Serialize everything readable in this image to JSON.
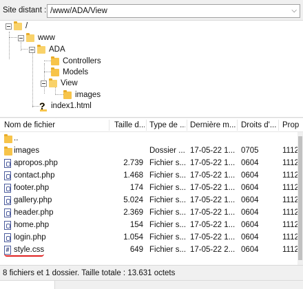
{
  "pathbar": {
    "label": "Site distant :",
    "value": "/www/ADA/View"
  },
  "tree": {
    "root": "/",
    "www": "www",
    "ada": "ADA",
    "controllers": "Controllers",
    "models": "Models",
    "view": "View",
    "images": "images",
    "index": "index1.html"
  },
  "columns": {
    "name": "Nom de fichier",
    "size": "Taille d...",
    "type": "Type de ...",
    "modified": "Dernière m...",
    "rights": "Droits d'...",
    "owner": "Propr"
  },
  "files": [
    {
      "name": "..",
      "size": "",
      "type": "",
      "modified": "",
      "rights": "",
      "owner": "",
      "icon": "folder-icon"
    },
    {
      "name": "images",
      "size": "",
      "type": "Dossier ...",
      "modified": "17-05-22 1...",
      "rights": "0705",
      "owner": "1112(",
      "icon": "folder-icon"
    },
    {
      "name": "apropos.php",
      "size": "2.739",
      "type": "Fichier s...",
      "modified": "17-05-22 1...",
      "rights": "0604",
      "owner": "1112(",
      "icon": "php-file-icon"
    },
    {
      "name": "contact.php",
      "size": "1.468",
      "type": "Fichier s...",
      "modified": "17-05-22 1...",
      "rights": "0604",
      "owner": "1112(",
      "icon": "php-file-icon"
    },
    {
      "name": "footer.php",
      "size": "174",
      "type": "Fichier s...",
      "modified": "17-05-22 1...",
      "rights": "0604",
      "owner": "1112(",
      "icon": "php-file-icon"
    },
    {
      "name": "gallery.php",
      "size": "5.024",
      "type": "Fichier s...",
      "modified": "17-05-22 1...",
      "rights": "0604",
      "owner": "1112(",
      "icon": "php-file-icon"
    },
    {
      "name": "header.php",
      "size": "2.369",
      "type": "Fichier s...",
      "modified": "17-05-22 1...",
      "rights": "0604",
      "owner": "1112(",
      "icon": "php-file-icon"
    },
    {
      "name": "home.php",
      "size": "154",
      "type": "Fichier s...",
      "modified": "17-05-22 1...",
      "rights": "0604",
      "owner": "1112(",
      "icon": "php-file-icon"
    },
    {
      "name": "login.php",
      "size": "1.054",
      "type": "Fichier s...",
      "modified": "17-05-22 1...",
      "rights": "0604",
      "owner": "1112(",
      "icon": "php-file-icon"
    },
    {
      "name": "style.css",
      "size": "649",
      "type": "Fichier s...",
      "modified": "17-05-22 2...",
      "rights": "0604",
      "owner": "1112(",
      "icon": "css-file-icon"
    }
  ],
  "status": "8 fichiers et 1 dossier. Taille totale : 13.631 octets",
  "colors": {
    "folder": "#f7c44a",
    "annotation": "#e02020"
  }
}
